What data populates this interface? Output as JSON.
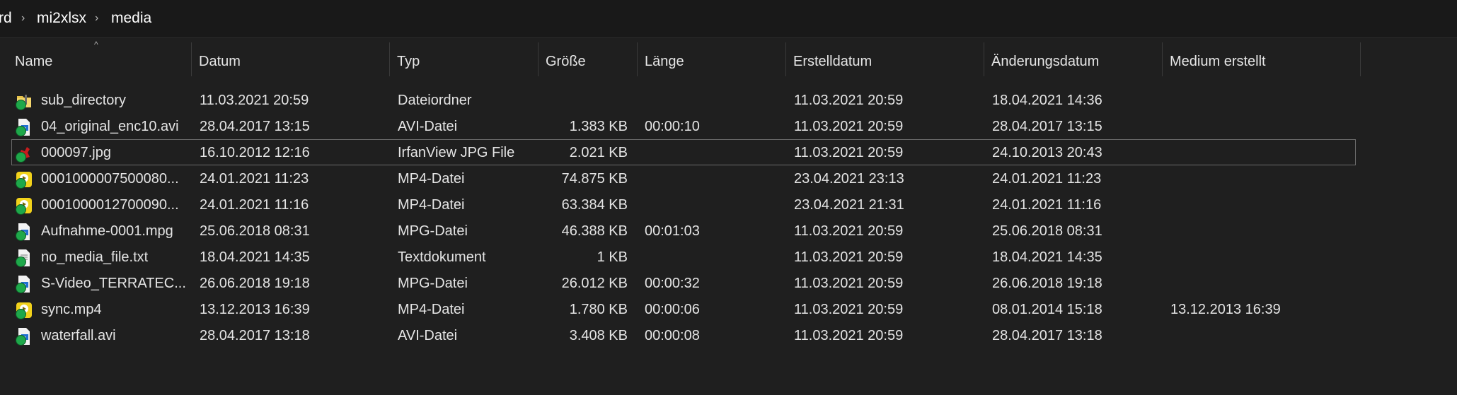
{
  "breadcrumb": {
    "items": [
      "rd",
      "mi2xlsx",
      "media"
    ],
    "separator": "›"
  },
  "columns": [
    "Name",
    "Datum",
    "Typ",
    "Größe",
    "Länge",
    "Erstelldatum",
    "Änderungsdatum",
    "Medium erstellt"
  ],
  "sort_indicator": "^",
  "files": [
    {
      "name": "sub_directory",
      "datum": "11.03.2021 20:59",
      "typ": "Dateiordner",
      "groesse": "",
      "laenge": "",
      "erstelldatum": "11.03.2021 20:59",
      "aenderungsdatum": "18.04.2021 14:36",
      "medium": "",
      "icon": "folder-icon"
    },
    {
      "name": "04_original_enc10.avi",
      "datum": "28.04.2017 13:15",
      "typ": "AVI-Datei",
      "groesse": "1.383 KB",
      "laenge": "00:00:10",
      "erstelldatum": "11.03.2021 20:59",
      "aenderungsdatum": "28.04.2017 13:15",
      "medium": "",
      "icon": "video-file-icon"
    },
    {
      "name": "000097.jpg",
      "datum": "16.10.2012 12:16",
      "typ": "IrfanView JPG File",
      "groesse": "2.021 KB",
      "laenge": "",
      "erstelldatum": "11.03.2021 20:59",
      "aenderungsdatum": "24.10.2013 20:43",
      "medium": "",
      "icon": "irfanview-icon"
    },
    {
      "name": "0001000007500080...",
      "datum": "24.01.2021 11:23",
      "typ": "MP4-Datei",
      "groesse": "74.875 KB",
      "laenge": "",
      "erstelldatum": "23.04.2021 23:13",
      "aenderungsdatum": "24.01.2021 11:23",
      "medium": "",
      "icon": "mp4-file-icon"
    },
    {
      "name": "0001000012700090...",
      "datum": "24.01.2021 11:16",
      "typ": "MP4-Datei",
      "groesse": "63.384 KB",
      "laenge": "",
      "erstelldatum": "23.04.2021 21:31",
      "aenderungsdatum": "24.01.2021 11:16",
      "medium": "",
      "icon": "mp4-file-icon"
    },
    {
      "name": "Aufnahme-0001.mpg",
      "datum": "25.06.2018 08:31",
      "typ": "MPG-Datei",
      "groesse": "46.388 KB",
      "laenge": "00:01:03",
      "erstelldatum": "11.03.2021 20:59",
      "aenderungsdatum": "25.06.2018 08:31",
      "medium": "",
      "icon": "video-file-icon"
    },
    {
      "name": "no_media_file.txt",
      "datum": "18.04.2021 14:35",
      "typ": "Textdokument",
      "groesse": "1 KB",
      "laenge": "",
      "erstelldatum": "11.03.2021 20:59",
      "aenderungsdatum": "18.04.2021 14:35",
      "medium": "",
      "icon": "text-file-icon"
    },
    {
      "name": "S-Video_TERRATEC...",
      "datum": "26.06.2018 19:18",
      "typ": "MPG-Datei",
      "groesse": "26.012 KB",
      "laenge": "00:00:32",
      "erstelldatum": "11.03.2021 20:59",
      "aenderungsdatum": "26.06.2018 19:18",
      "medium": "",
      "icon": "video-file-icon"
    },
    {
      "name": "sync.mp4",
      "datum": "13.12.2013 16:39",
      "typ": "MP4-Datei",
      "groesse": "1.780 KB",
      "laenge": "00:00:06",
      "erstelldatum": "11.03.2021 20:59",
      "aenderungsdatum": "08.01.2014 15:18",
      "medium": "13.12.2013 16:39",
      "icon": "mp4-file-icon"
    },
    {
      "name": "waterfall.avi",
      "datum": "28.04.2017 13:18",
      "typ": "AVI-Datei",
      "groesse": "3.408 KB",
      "laenge": "00:00:08",
      "erstelldatum": "11.03.2021 20:59",
      "aenderungsdatum": "28.04.2017 13:18",
      "medium": "",
      "icon": "video-file-icon"
    }
  ],
  "focused_row": 2,
  "colors": {
    "background": "#1f1f1f",
    "text": "#e4e4e4",
    "sync_check": "#1ea84a",
    "folder": "#e8c34a",
    "mp4_icon": "#f2d21b",
    "irfanview": "#c81d1d"
  }
}
